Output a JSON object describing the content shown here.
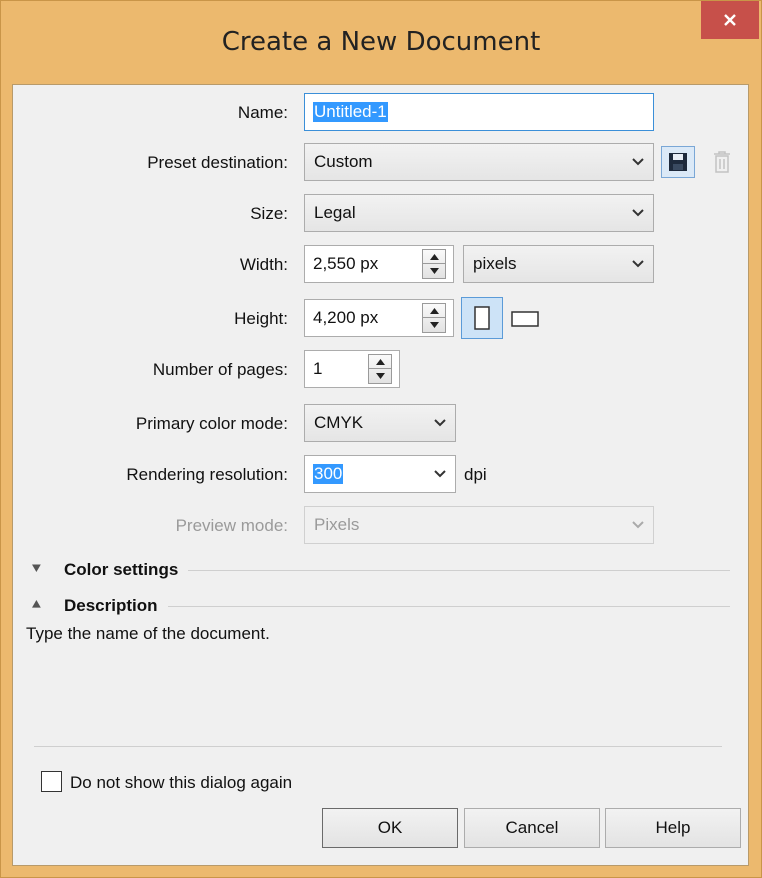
{
  "window": {
    "title": "Create a New Document",
    "close_icon": "close-icon"
  },
  "form": {
    "name": {
      "label": "Name:",
      "value": "Untitled-1"
    },
    "preset": {
      "label": "Preset destination:",
      "value": "Custom",
      "save_icon": "floppy-disk-icon",
      "delete_icon": "trash-icon"
    },
    "size": {
      "label": "Size:",
      "value": "Legal"
    },
    "width": {
      "label": "Width:",
      "value": "2,550 px",
      "unit": "pixels"
    },
    "height": {
      "label": "Height:",
      "value": "4,200 px",
      "portrait_icon": "portrait-orientation-icon",
      "landscape_icon": "landscape-orientation-icon"
    },
    "pages": {
      "label": "Number of pages:",
      "value": "1"
    },
    "color_mode": {
      "label": "Primary color mode:",
      "value": "CMYK"
    },
    "resolution": {
      "label": "Rendering resolution:",
      "value": "300",
      "unit": "dpi"
    },
    "preview": {
      "label": "Preview mode:",
      "value": "Pixels"
    }
  },
  "sections": {
    "color_settings": {
      "label": "Color settings",
      "state": "collapsed"
    },
    "description": {
      "label": "Description",
      "state": "expanded",
      "text": "Type the name of the document."
    }
  },
  "footer": {
    "dont_show_label": "Do not show this dialog again",
    "dont_show_checked": false,
    "ok_label": "OK",
    "cancel_label": "Cancel",
    "help_label": "Help"
  },
  "colors": {
    "title_bar": "#ecb96e",
    "close_button": "#c7504a",
    "selection": "#3399ff",
    "focus_border": "#3b8fd8"
  }
}
